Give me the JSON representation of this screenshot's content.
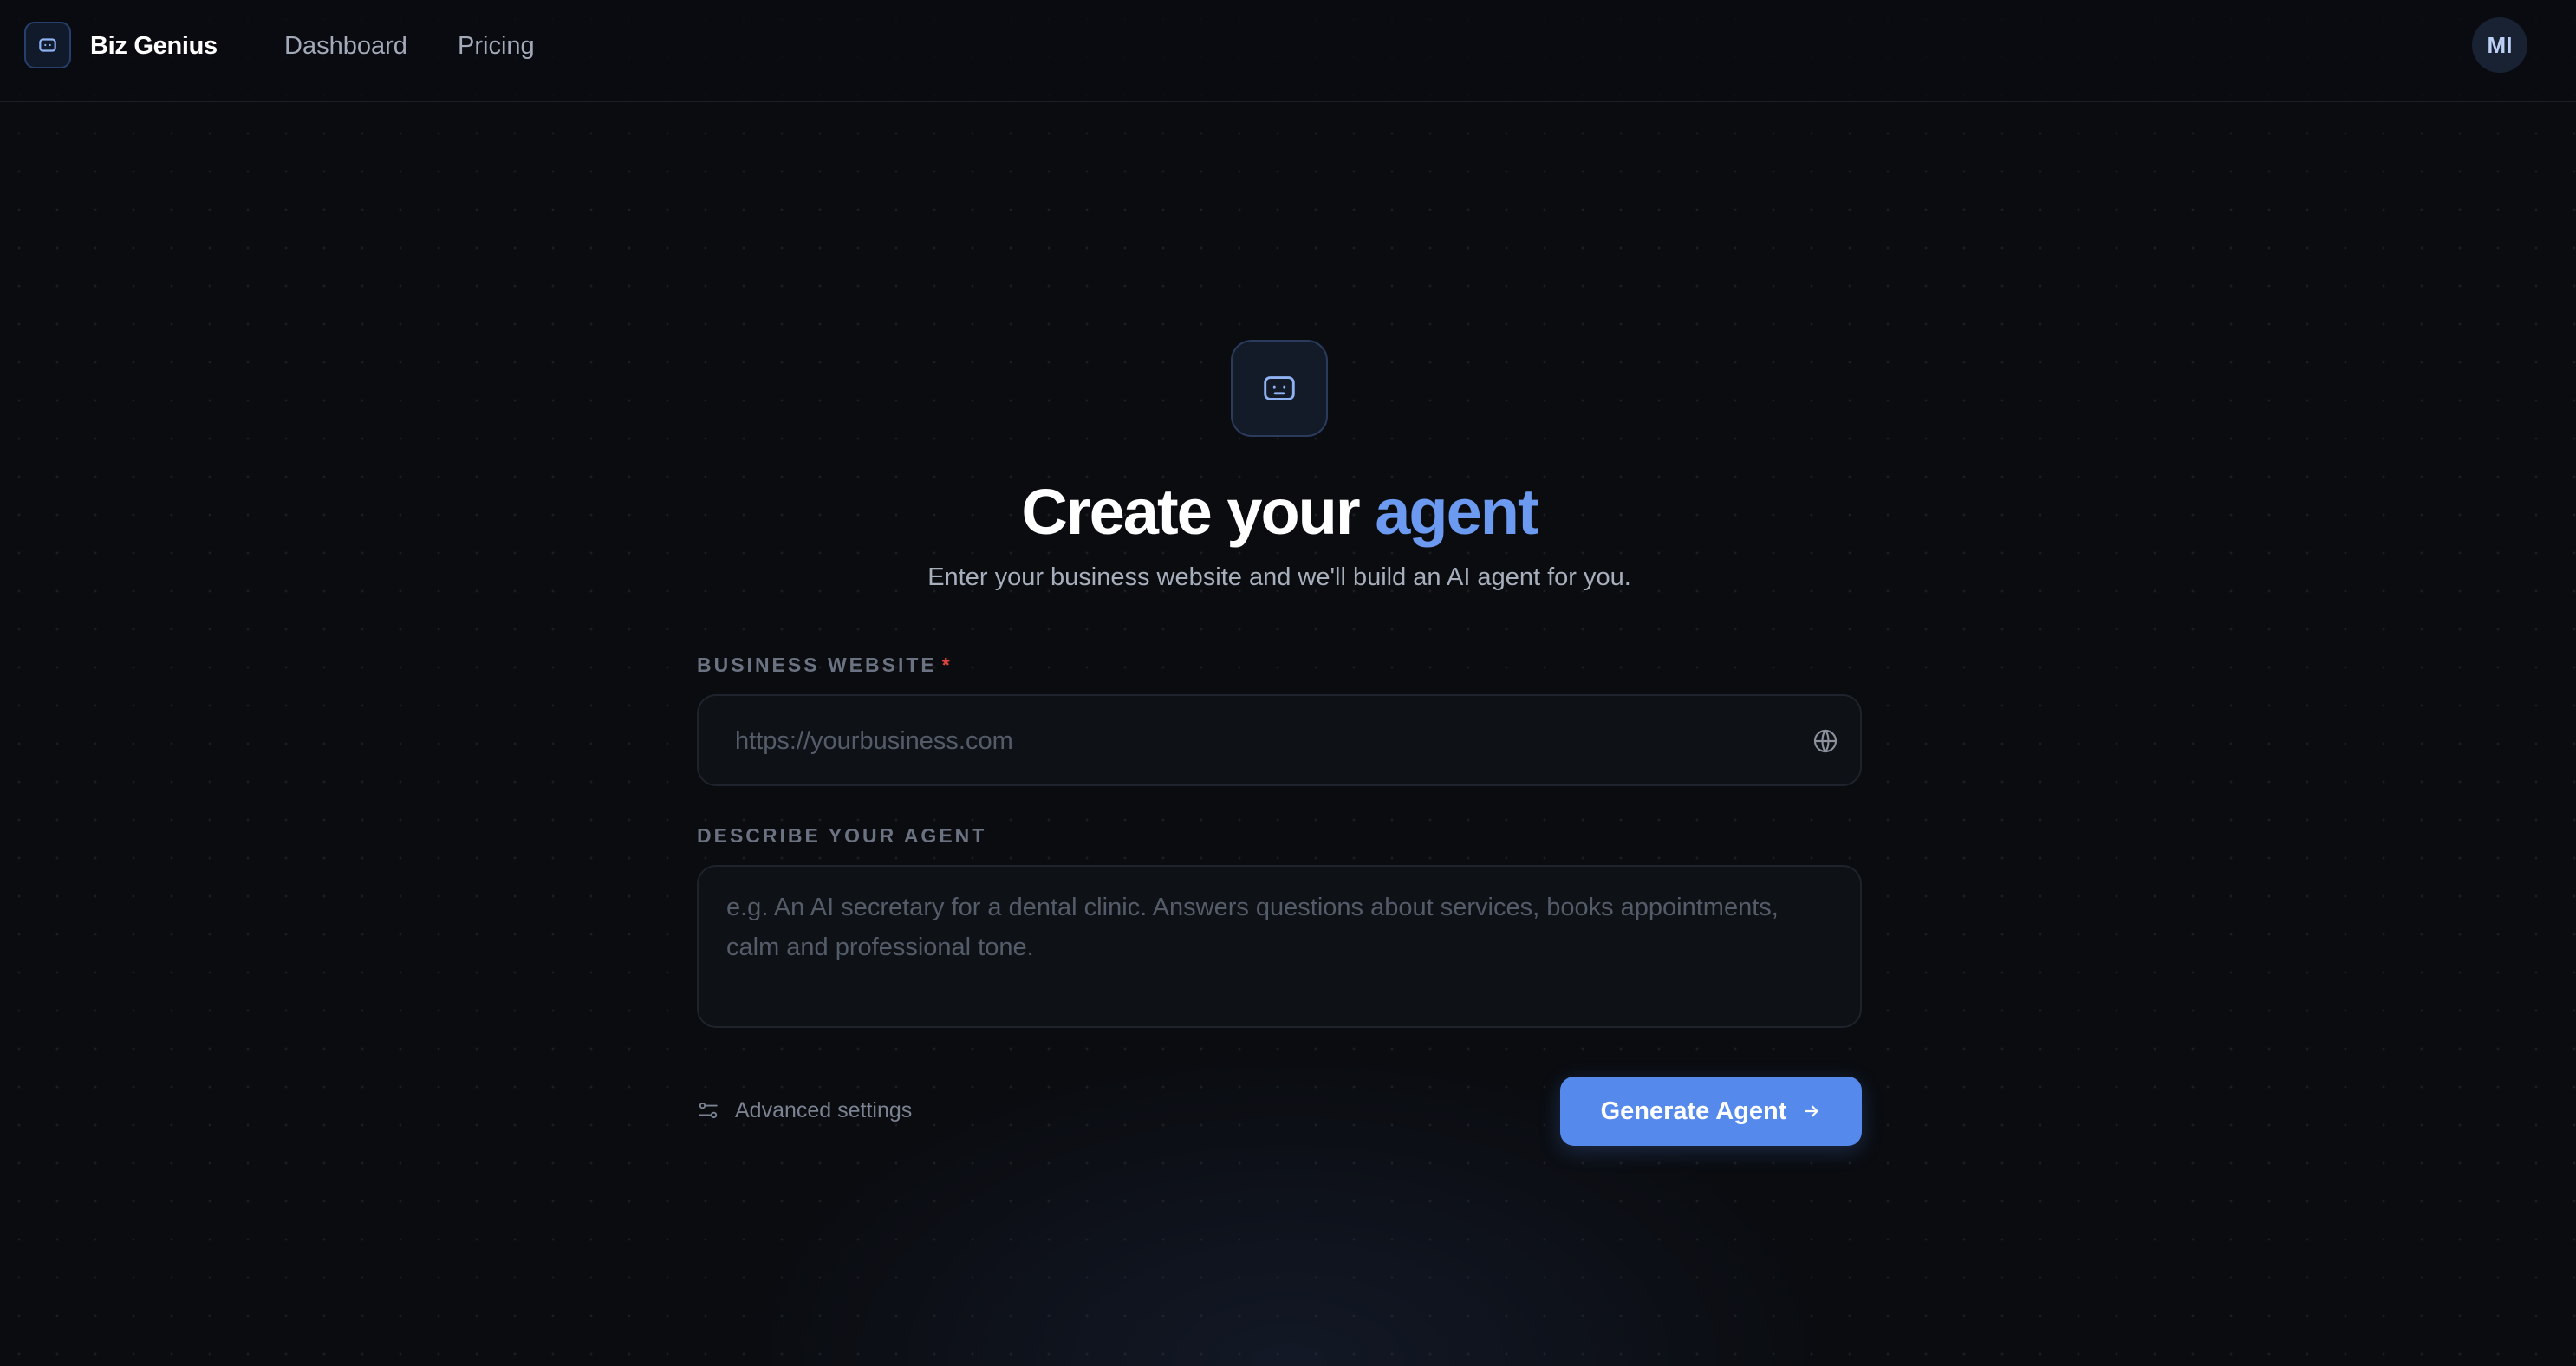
{
  "header": {
    "brand": "Biz Genius",
    "nav": [
      {
        "label": "Dashboard"
      },
      {
        "label": "Pricing"
      }
    ],
    "avatar_initials": "MI"
  },
  "hero": {
    "icon": "robot-face-icon",
    "title_main": "Create your",
    "title_accent": "agent",
    "subtitle": "Enter your business website and we'll build an AI agent for you."
  },
  "form": {
    "website": {
      "label": "BUSINESS WEBSITE",
      "required_marker": "*",
      "value": "",
      "placeholder": "https://yourbusiness.com",
      "icon": "globe-icon"
    },
    "description": {
      "label": "DESCRIBE YOUR AGENT",
      "value": "",
      "placeholder": "e.g. An AI secretary for a dental clinic. Answers questions about services, books appointments, calm and professional tone."
    },
    "advanced_settings": {
      "label": "Advanced settings",
      "icon": "sliders-icon"
    },
    "submit": {
      "label": "Generate Agent",
      "icon": "arrow-right-icon"
    }
  },
  "colors": {
    "accent": "#5589ec",
    "accent_text": "#6b9af0",
    "background": "#0a0c10",
    "required": "#e0463e"
  }
}
